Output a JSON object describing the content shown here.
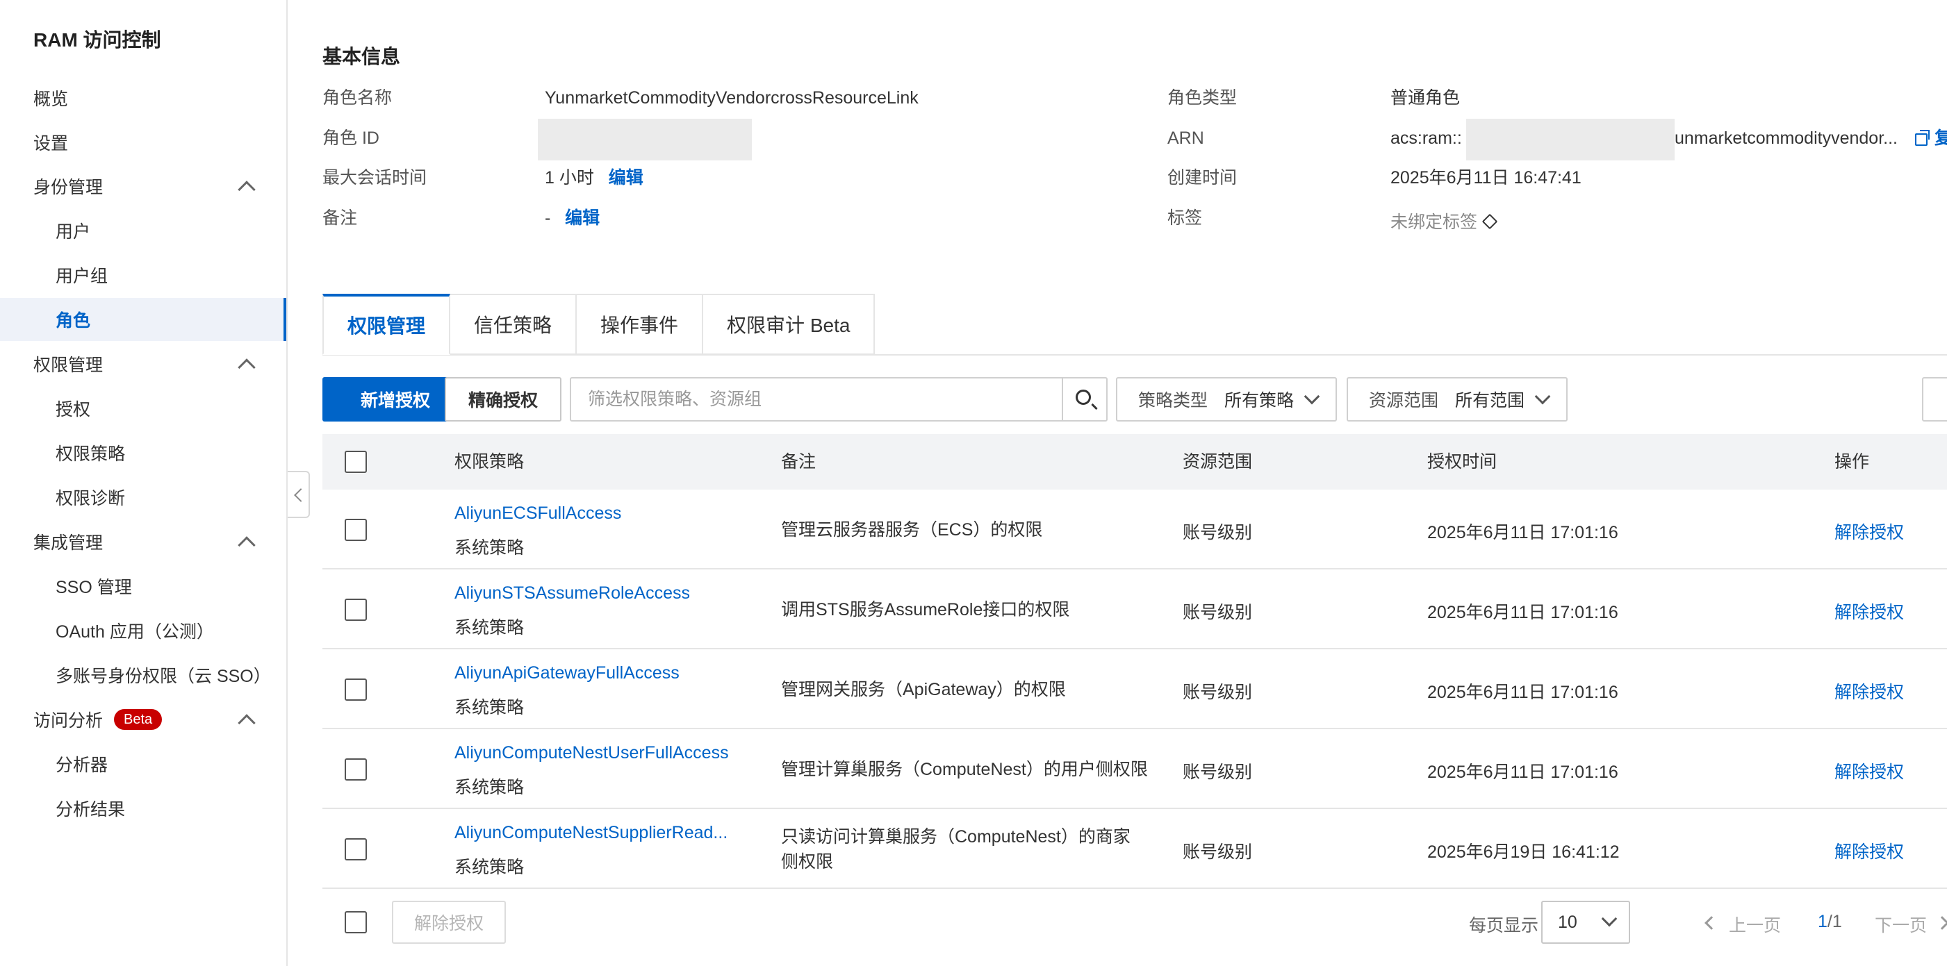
{
  "sidebar": {
    "title": "RAM 访问控制",
    "items": [
      {
        "label": "概览"
      },
      {
        "label": "设置"
      },
      {
        "label": "身份管理"
      },
      {
        "label": "用户"
      },
      {
        "label": "用户组"
      },
      {
        "label": "角色"
      },
      {
        "label": "权限管理"
      },
      {
        "label": "授权"
      },
      {
        "label": "权限策略"
      },
      {
        "label": "权限诊断"
      },
      {
        "label": "集成管理"
      },
      {
        "label": "SSO 管理"
      },
      {
        "label": "OAuth 应用（公测）"
      },
      {
        "label": "多账号身份权限（云 SSO）"
      },
      {
        "label": "访问分析"
      },
      {
        "label": "分析器"
      },
      {
        "label": "分析结果"
      }
    ],
    "beta_badge": "Beta",
    "active_item": "角色"
  },
  "basic_info": {
    "title": "基本信息",
    "role_name_label": "角色名称",
    "role_name": "YunmarketCommodityVendorcrossResourceLink",
    "role_id_label": "角色 ID",
    "max_session_label": "最大会话时间",
    "max_session_value": "1 小时",
    "edit": "编辑",
    "remark_label": "备注",
    "remark_value": "-",
    "role_type_label": "角色类型",
    "role_type_value": "普通角色",
    "arn_label": "ARN",
    "arn_prefix": "acs:ram::",
    "arn_suffix": "unmarketcommodityvendor...",
    "copy_label": "复",
    "created_label": "创建时间",
    "created_value": "2025年6月11日 16:47:41",
    "tags_label": "标签",
    "tags_value": "未绑定标签"
  },
  "tabs": [
    {
      "label": "权限管理",
      "active": true
    },
    {
      "label": "信任策略",
      "active": false
    },
    {
      "label": "操作事件",
      "active": false
    },
    {
      "label": "权限审计 Beta",
      "active": false
    }
  ],
  "toolbar": {
    "add_grant": "新增授权",
    "precise_grant": "精确授权",
    "search_placeholder": "筛选权限策略、资源组",
    "policy_type_label": "策略类型",
    "policy_type_value": "所有策略",
    "resource_scope_label": "资源范围",
    "resource_scope_value": "所有范围"
  },
  "table": {
    "headers": {
      "policy": "权限策略",
      "remark": "备注",
      "scope": "资源范围",
      "time": "授权时间",
      "action": "操作"
    },
    "rows": [
      {
        "name": "AliyunECSFullAccess",
        "type": "系统策略",
        "remark": "管理云服务器服务（ECS）的权限",
        "scope": "账号级别",
        "time": "2025年6月11日 17:01:16",
        "action": "解除授权"
      },
      {
        "name": "AliyunSTSAssumeRoleAccess",
        "type": "系统策略",
        "remark": "调用STS服务AssumeRole接口的权限",
        "scope": "账号级别",
        "time": "2025年6月11日 17:01:16",
        "action": "解除授权"
      },
      {
        "name": "AliyunApiGatewayFullAccess",
        "type": "系统策略",
        "remark": "管理网关服务（ApiGateway）的权限",
        "scope": "账号级别",
        "time": "2025年6月11日 17:01:16",
        "action": "解除授权"
      },
      {
        "name": "AliyunComputeNestUserFullAccess",
        "type": "系统策略",
        "remark": "管理计算巢服务（ComputeNest）的用户侧权限",
        "scope": "账号级别",
        "time": "2025年6月11日 17:01:16",
        "action": "解除授权"
      },
      {
        "name": "AliyunComputeNestSupplierRead...",
        "type": "系统策略",
        "remark": "只读访问计算巢服务（ComputeNest）的商家侧权限",
        "scope": "账号级别",
        "time": "2025年6月19日 16:41:12",
        "action": "解除授权"
      }
    ]
  },
  "footer": {
    "bulk_revoke": "解除授权",
    "page_size_label": "每页显示",
    "page_size": "10",
    "prev": "上一页",
    "page_current": "1",
    "page_total": "/1",
    "next": "下一页"
  },
  "colors": {
    "primary": "#0064c8",
    "badge_red": "#c80000",
    "table_header_bg": "#f2f3f5"
  }
}
